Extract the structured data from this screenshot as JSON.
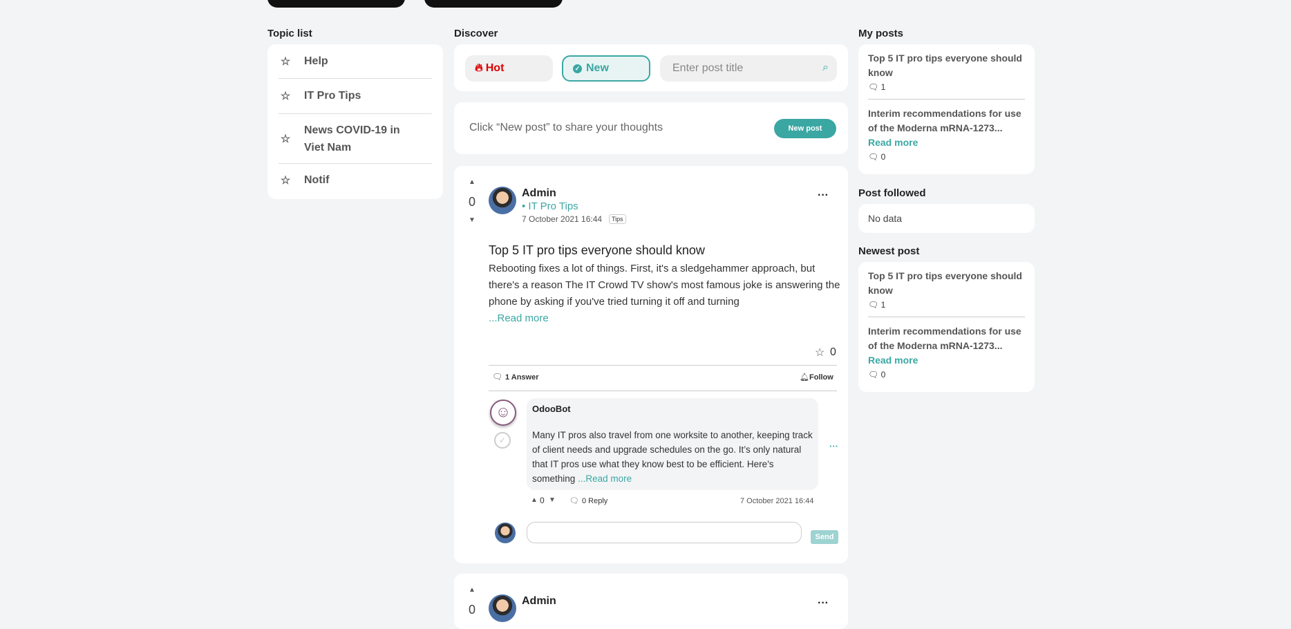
{
  "topics": {
    "title": "Topic list",
    "items": [
      "Help",
      "IT Pro Tips",
      "News COVID-19 in Viet Nam",
      "Notif"
    ]
  },
  "discover": {
    "title": "Discover",
    "hot_label": "Hot",
    "new_label": "New",
    "search_placeholder": "Enter post title"
  },
  "composer": {
    "prompt": "Click “New post” to share your thoughts",
    "button": "New post"
  },
  "post": {
    "votes": "0",
    "author": "Admin",
    "topic": "• IT Pro Tips",
    "date": "7 October 2021 16:44",
    "tag": "Tips",
    "title": "Top 5 IT pro tips everyone should know",
    "body": "Rebooting fixes a lot of things. First, it's a sledgehammer approach, but there's a reason The IT Crowd TV show's most famous joke is answering the phone by asking if you've tried turning it off and turning",
    "read_more": "...Read more",
    "favorites": "0",
    "answers": "1 Answer",
    "follow": "Follow",
    "answer": {
      "author": "OdooBot",
      "body": "Many IT pros also travel from one worksite to another, keeping track of client needs and upgrade schedules on the go. It’s only natural that IT pros use what they know best to be efficient. Here's something",
      "read_more": "...Read more",
      "votes": "0",
      "reply": "0 Reply",
      "date": "7 October 2021 16:44"
    },
    "send": "Send"
  },
  "post2": {
    "votes": "0",
    "author": "Admin"
  },
  "my_posts": {
    "title": "My posts",
    "items": [
      {
        "title": "Top 5 IT pro tips everyone should know",
        "count": "1"
      },
      {
        "title": "Interim recommendations for use of the Moderna mRNA-1273...",
        "read_more": "Read more",
        "count": "0"
      }
    ]
  },
  "followed": {
    "title": "Post followed",
    "empty": "No data"
  },
  "newest": {
    "title": "Newest post",
    "items": [
      {
        "title": "Top 5 IT pro tips everyone should know",
        "count": "1"
      },
      {
        "title": "Interim recommendations for use of the Moderna mRNA-1273...",
        "read_more": "Read more",
        "count": "0"
      }
    ]
  },
  "colors": {
    "accent": "#3aa7a3",
    "hot": "#dd0000",
    "background": "#f3f4f6"
  }
}
